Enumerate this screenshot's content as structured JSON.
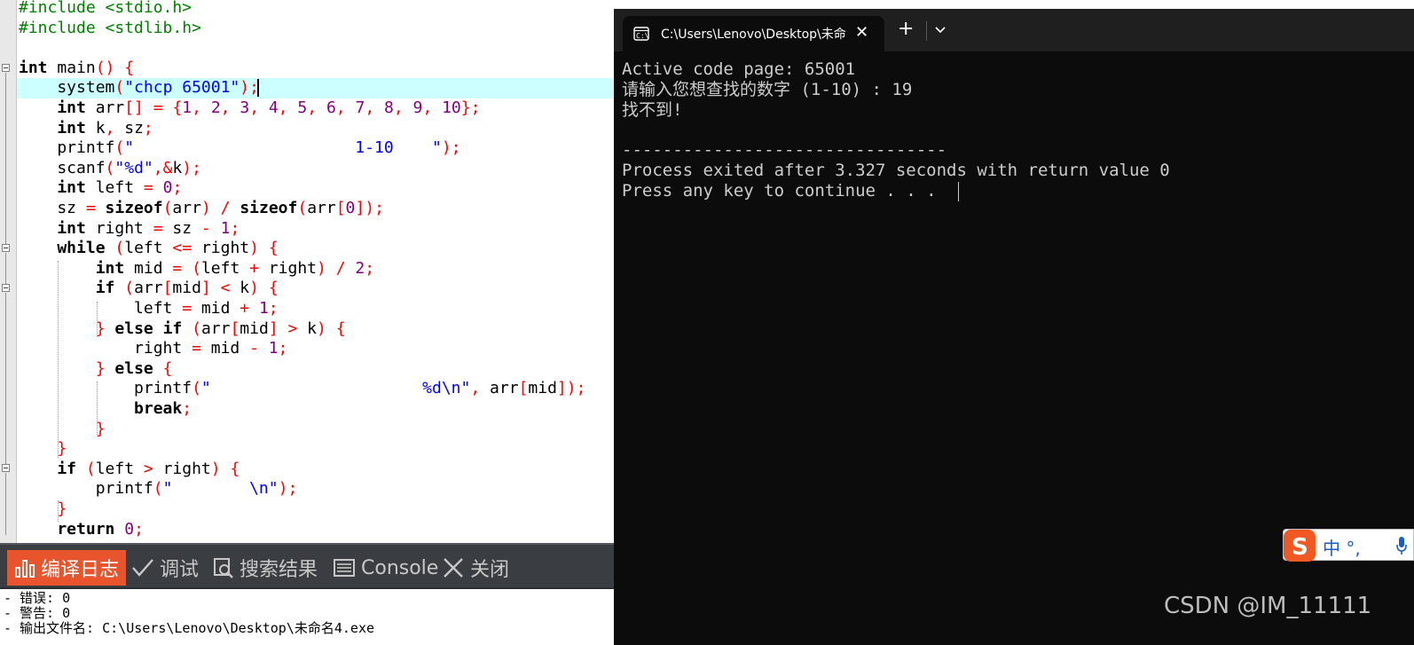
{
  "editor": {
    "lines": [
      [
        [
          "pp",
          "#include <stdio.h>"
        ]
      ],
      [
        [
          "pp",
          "#include <stdlib.h>"
        ]
      ],
      [],
      [
        [
          "kw",
          "int"
        ],
        [
          "id",
          " main"
        ],
        [
          "op",
          "()"
        ],
        [
          "id",
          " "
        ],
        [
          "op",
          "{"
        ]
      ],
      [
        [
          "id",
          "    system"
        ],
        [
          "op",
          "("
        ],
        [
          "str",
          "\"chcp 65001\""
        ],
        [
          "op",
          ");"
        ]
      ],
      [
        [
          "kw",
          "    int"
        ],
        [
          "id",
          " arr"
        ],
        [
          "op",
          "[]"
        ],
        [
          "id",
          " "
        ],
        [
          "op",
          "="
        ],
        [
          "id",
          " "
        ],
        [
          "op",
          "{"
        ],
        [
          "num",
          "1"
        ],
        [
          "op",
          ","
        ],
        [
          "id",
          " "
        ],
        [
          "num",
          "2"
        ],
        [
          "op",
          ","
        ],
        [
          "id",
          " "
        ],
        [
          "num",
          "3"
        ],
        [
          "op",
          ","
        ],
        [
          "id",
          " "
        ],
        [
          "num",
          "4"
        ],
        [
          "op",
          ","
        ],
        [
          "id",
          " "
        ],
        [
          "num",
          "5"
        ],
        [
          "op",
          ","
        ],
        [
          "id",
          " "
        ],
        [
          "num",
          "6"
        ],
        [
          "op",
          ","
        ],
        [
          "id",
          " "
        ],
        [
          "num",
          "7"
        ],
        [
          "op",
          ","
        ],
        [
          "id",
          " "
        ],
        [
          "num",
          "8"
        ],
        [
          "op",
          ","
        ],
        [
          "id",
          " "
        ],
        [
          "num",
          "9"
        ],
        [
          "op",
          ","
        ],
        [
          "id",
          " "
        ],
        [
          "num",
          "10"
        ],
        [
          "op",
          "};"
        ]
      ],
      [
        [
          "kw",
          "    int"
        ],
        [
          "id",
          " k"
        ],
        [
          "op",
          ","
        ],
        [
          "id",
          " sz"
        ],
        [
          "op",
          ";"
        ]
      ],
      [
        [
          "id",
          "    printf"
        ],
        [
          "op",
          "("
        ],
        [
          "str",
          "\"                       1-10    \""
        ],
        [
          "op",
          ");"
        ]
      ],
      [
        [
          "id",
          "    scanf"
        ],
        [
          "op",
          "("
        ],
        [
          "str",
          "\"%d\""
        ],
        [
          "op",
          ",&"
        ],
        [
          "id",
          "k"
        ],
        [
          "op",
          ");"
        ]
      ],
      [
        [
          "kw",
          "    int"
        ],
        [
          "id",
          " left "
        ],
        [
          "op",
          "="
        ],
        [
          "id",
          " "
        ],
        [
          "num",
          "0"
        ],
        [
          "op",
          ";"
        ]
      ],
      [
        [
          "id",
          "    sz "
        ],
        [
          "op",
          "="
        ],
        [
          "id",
          " "
        ],
        [
          "kw",
          "sizeof"
        ],
        [
          "op",
          "("
        ],
        [
          "id",
          "arr"
        ],
        [
          "op",
          ")"
        ],
        [
          "id",
          " "
        ],
        [
          "op",
          "/"
        ],
        [
          "id",
          " "
        ],
        [
          "kw",
          "sizeof"
        ],
        [
          "op",
          "("
        ],
        [
          "id",
          "arr"
        ],
        [
          "op",
          "["
        ],
        [
          "num",
          "0"
        ],
        [
          "op",
          "]);"
        ]
      ],
      [
        [
          "kw",
          "    int"
        ],
        [
          "id",
          " right "
        ],
        [
          "op",
          "="
        ],
        [
          "id",
          " sz "
        ],
        [
          "op",
          "-"
        ],
        [
          "id",
          " "
        ],
        [
          "num",
          "1"
        ],
        [
          "op",
          ";"
        ]
      ],
      [
        [
          "kw",
          "    while"
        ],
        [
          "id",
          " "
        ],
        [
          "op",
          "("
        ],
        [
          "id",
          "left "
        ],
        [
          "op",
          "<="
        ],
        [
          "id",
          " right"
        ],
        [
          "op",
          ")"
        ],
        [
          "id",
          " "
        ],
        [
          "op",
          "{"
        ]
      ],
      [
        [
          "kw",
          "        int"
        ],
        [
          "id",
          " mid "
        ],
        [
          "op",
          "="
        ],
        [
          "id",
          " "
        ],
        [
          "op",
          "("
        ],
        [
          "id",
          "left "
        ],
        [
          "op",
          "+"
        ],
        [
          "id",
          " right"
        ],
        [
          "op",
          ")"
        ],
        [
          "id",
          " "
        ],
        [
          "op",
          "/"
        ],
        [
          "id",
          " "
        ],
        [
          "num",
          "2"
        ],
        [
          "op",
          ";"
        ]
      ],
      [
        [
          "kw",
          "        if"
        ],
        [
          "id",
          " "
        ],
        [
          "op",
          "("
        ],
        [
          "id",
          "arr"
        ],
        [
          "op",
          "["
        ],
        [
          "id",
          "mid"
        ],
        [
          "op",
          "]"
        ],
        [
          "id",
          " "
        ],
        [
          "op",
          "<"
        ],
        [
          "id",
          " k"
        ],
        [
          "op",
          ")"
        ],
        [
          "id",
          " "
        ],
        [
          "op",
          "{"
        ]
      ],
      [
        [
          "id",
          "            left "
        ],
        [
          "op",
          "="
        ],
        [
          "id",
          " mid "
        ],
        [
          "op",
          "+"
        ],
        [
          "id",
          " "
        ],
        [
          "num",
          "1"
        ],
        [
          "op",
          ";"
        ]
      ],
      [
        [
          "op",
          "        }"
        ],
        [
          "id",
          " "
        ],
        [
          "kw",
          "else if"
        ],
        [
          "id",
          " "
        ],
        [
          "op",
          "("
        ],
        [
          "id",
          "arr"
        ],
        [
          "op",
          "["
        ],
        [
          "id",
          "mid"
        ],
        [
          "op",
          "]"
        ],
        [
          "id",
          " "
        ],
        [
          "op",
          ">"
        ],
        [
          "id",
          " k"
        ],
        [
          "op",
          ")"
        ],
        [
          "id",
          " "
        ],
        [
          "op",
          "{"
        ]
      ],
      [
        [
          "id",
          "            right "
        ],
        [
          "op",
          "="
        ],
        [
          "id",
          " mid "
        ],
        [
          "op",
          "-"
        ],
        [
          "id",
          " "
        ],
        [
          "num",
          "1"
        ],
        [
          "op",
          ";"
        ]
      ],
      [
        [
          "op",
          "        }"
        ],
        [
          "id",
          " "
        ],
        [
          "kw",
          "else"
        ],
        [
          "id",
          " "
        ],
        [
          "op",
          "{"
        ]
      ],
      [
        [
          "id",
          "            printf"
        ],
        [
          "op",
          "("
        ],
        [
          "str",
          "\"                      %d\\n\""
        ],
        [
          "op",
          ","
        ],
        [
          "id",
          " arr"
        ],
        [
          "op",
          "["
        ],
        [
          "id",
          "mid"
        ],
        [
          "op",
          "]);"
        ]
      ],
      [
        [
          "kw",
          "            break"
        ],
        [
          "op",
          ";"
        ]
      ],
      [
        [
          "op",
          "        }"
        ]
      ],
      [
        [
          "op",
          "    }"
        ]
      ],
      [
        [
          "kw",
          "    if"
        ],
        [
          "id",
          " "
        ],
        [
          "op",
          "("
        ],
        [
          "id",
          "left "
        ],
        [
          "op",
          ">"
        ],
        [
          "id",
          " right"
        ],
        [
          "op",
          ")"
        ],
        [
          "id",
          " "
        ],
        [
          "op",
          "{"
        ]
      ],
      [
        [
          "id",
          "        printf"
        ],
        [
          "op",
          "("
        ],
        [
          "str",
          "\"        \\n\""
        ],
        [
          "op",
          ");"
        ]
      ],
      [
        [
          "op",
          "    }"
        ]
      ],
      [
        [
          "kw",
          "    return"
        ],
        [
          "id",
          " "
        ],
        [
          "num",
          "0"
        ],
        [
          "op",
          ";"
        ]
      ]
    ]
  },
  "panel": {
    "tabs": [
      {
        "label": "编译日志",
        "icon": "bar-chart-icon",
        "active": true
      },
      {
        "label": "调试",
        "icon": "check-icon",
        "active": false
      },
      {
        "label": "搜索结果",
        "icon": "search-icon",
        "active": false
      },
      {
        "label": "Console",
        "icon": "console-icon",
        "active": false
      },
      {
        "label": "关闭",
        "icon": "close-icon",
        "active": false
      }
    ],
    "log": [
      "- 错误: 0",
      "- 警告: 0",
      "- 输出文件名: C:\\Users\\Lenovo\\Desktop\\未命名4.exe"
    ]
  },
  "terminal": {
    "tab_title": "C:\\Users\\Lenovo\\Desktop\\未命",
    "lines": [
      "Active code page: 65001",
      "请输入您想查找的数字 (1-10) : 19",
      "找不到!",
      "",
      "--------------------------------",
      "Process exited after 3.327 seconds with return value 0",
      "Press any key to continue . . . "
    ]
  },
  "ime": {
    "text": "中 °,"
  },
  "watermark": "CSDN @IM_11111",
  "colors": {
    "preprocessor": "#008000",
    "keyword": "#000000",
    "operator": "#ff0000",
    "number": "#800080",
    "string": "#0000ff",
    "current_line": "#ccffff",
    "active_tab": "#e8542c",
    "terminal_bg": "#0c0c0c",
    "terminal_text": "#cccccc"
  }
}
